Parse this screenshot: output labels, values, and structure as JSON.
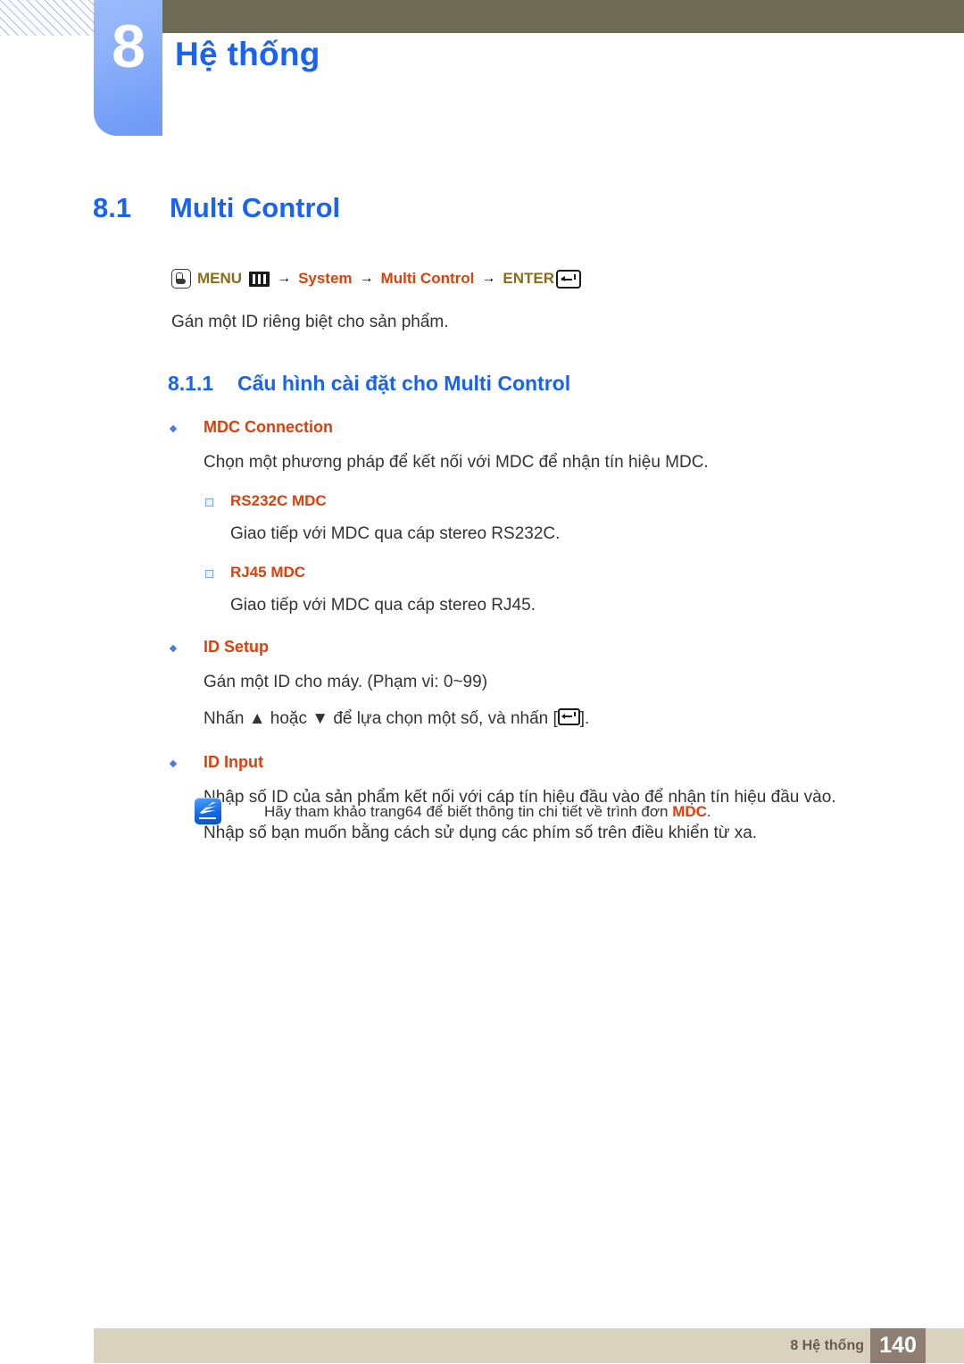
{
  "header": {
    "chapter_number": "8",
    "chapter_title": "Hệ thống"
  },
  "section": {
    "number": "8.1",
    "title": "Multi Control"
  },
  "menu_path": {
    "press_icon": "hand-press-icon",
    "menu_label": "MENU",
    "menu_icon": "menu-bars-icon",
    "arrow": "→",
    "item1": "System",
    "item2": "Multi Control",
    "enter_label": "ENTER",
    "enter_icon": "enter-key-icon"
  },
  "intro": "Gán một ID riêng biệt cho sản phẩm.",
  "subsection": {
    "number": "8.1.1",
    "title": "Cấu hình cài đặt cho Multi Control"
  },
  "items": [
    {
      "head": "MDC Connection",
      "para": "Chọn một phương pháp để kết nối với MDC để nhận tín hiệu MDC.",
      "subitems": [
        {
          "head": "RS232C MDC",
          "para": "Giao tiếp với MDC qua cáp stereo RS232C."
        },
        {
          "head": "RJ45 MDC",
          "para": "Giao tiếp với MDC qua cáp stereo RJ45."
        }
      ]
    },
    {
      "head": "ID Setup",
      "para": "Gán một ID cho máy. (Phạm vi: 0~99)",
      "para2_before": "Nhấn ▲ hoặc ▼ để lựa chọn một số, và nhấn [",
      "para2_after": "]."
    },
    {
      "head": "ID Input",
      "para": "Nhập số ID của sản phẩm kết nối với cáp tín hiệu đầu vào để nhận tín hiệu đầu vào.",
      "para2": "Nhập số bạn muốn bằng cách sử dụng các phím số trên điều khiển từ xa."
    }
  ],
  "note": {
    "icon": "note-pen-icon",
    "text_before": "Hãy tham khảo trang64 để biết thông tin chi tiết về trình đơn ",
    "accent": "MDC",
    "text_after": "."
  },
  "footer": {
    "label": "8 Hệ thống",
    "page": "140"
  },
  "colors": {
    "heading_blue": "#1a62f0",
    "accent_orange": "#d9410d",
    "olive": "#8a6d1b",
    "top_bar": "#6d6b56",
    "footer_bar": "#d8d2bf",
    "footer_page_bg": "#8d7d72"
  }
}
